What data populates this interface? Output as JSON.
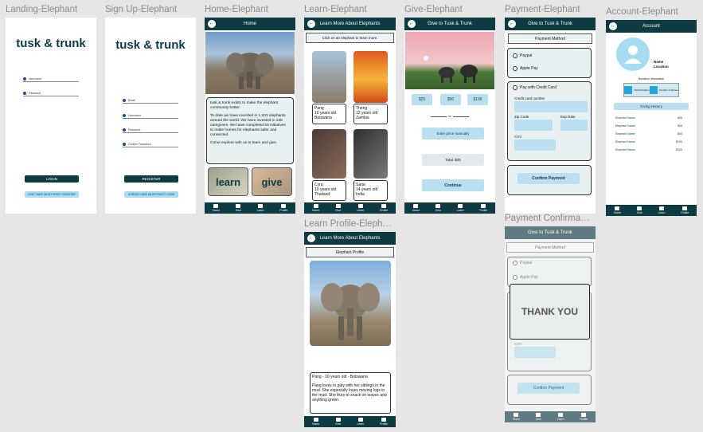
{
  "frames": {
    "landing": "Landing-Elephant",
    "signup": "Sign Up-Elephant",
    "home": "Home-Elephant",
    "learn": "Learn-Elephant",
    "give": "Give-Elephant",
    "payment": "Payment-Elephant",
    "account": "Account-Elephant",
    "learn_profile": "Learn Profile-Eleph…",
    "payment_confirm": "Payment Confirma…"
  },
  "brand": "tusk & trunk",
  "nav": [
    "Home",
    "Give",
    "Learn",
    "Profile"
  ],
  "landing": {
    "username": "Username",
    "password": "Password",
    "login": "LOGIN",
    "register": "DON'T HAVE AN ACCOUNT? REGISTER"
  },
  "signup": {
    "email": "Email",
    "username": "Username",
    "password": "Password",
    "confirm": "Confirm Password",
    "register": "REGISTER",
    "login": "ALREADY HAVE AN ACCOUNT? LOGIN"
  },
  "home": {
    "title": "Home",
    "p1": "tusk & trunk exists to make the elephant community better.",
    "p2": "To date we have invested in 1,203 elephants around the world. We have invested in 236 caregivers. We have completed 54 initiatives to make homes for elephants safer and connected.",
    "p3": "Come explore with us to learn and give.",
    "learn": "learn",
    "give": "give"
  },
  "learn": {
    "title": "Learn More About Elephants",
    "hint": "Click on an elephant to learn more.",
    "cards": [
      {
        "name": "Pang",
        "age": "10 years old",
        "place": "Botswana"
      },
      {
        "name": "Theng",
        "age": "12 years old",
        "place": "Zambia"
      },
      {
        "name": "Cyra",
        "age": "10 years old",
        "place": "Thailand"
      },
      {
        "name": "Sarai",
        "age": "14 years old",
        "place": "India"
      }
    ]
  },
  "give": {
    "title": "Give to Tusk & Trunk",
    "amounts": [
      "$25",
      "$50",
      "$100"
    ],
    "or": "or",
    "manual": "Enter price manually",
    "total": "Total: $25",
    "continue": "Continue"
  },
  "payment": {
    "title": "Give to Tusk & Trunk",
    "method": "Payment Method",
    "paypal": "Paypal",
    "applepay": "Apple Pay",
    "credit": "Pay with Credit Card",
    "card_number": "Credit card number",
    "zip": "Zip Code",
    "exp": "Exp Date",
    "cvv": "CVV",
    "confirm": "Confirm Payment"
  },
  "account": {
    "title": "Account",
    "name": "Name",
    "location": "Location",
    "donate_info": "Donation Information",
    "stat1": "Total Donation",
    "stat2": "Number of Donos",
    "history": "Giving History",
    "rows": [
      {
        "name": "Elephant Name",
        "amt": "$50"
      },
      {
        "name": "Elephant Name",
        "amt": "$50"
      },
      {
        "name": "Elephant Name",
        "amt": "$50"
      },
      {
        "name": "Elephant Name",
        "amt": "$100"
      },
      {
        "name": "Elephant Name",
        "amt": "$100"
      }
    ]
  },
  "profile": {
    "title": "Learn More About Elephants",
    "sub": "Elephant Profile",
    "heading": "Pang - 10 years old - Botswana",
    "body": "Pang loves to play with her siblings in the mud. She especially loves moving logs in the mud. She likes to snack on leaves and anything green."
  },
  "confirm": {
    "title": "Give to Tusk & Trunk",
    "method": "Payment Method",
    "paypal": "Paypal",
    "applepay": "Apple Pay",
    "thanks": "THANK YOU",
    "cvv": "CVV",
    "confirm": "Confirm Payment"
  }
}
